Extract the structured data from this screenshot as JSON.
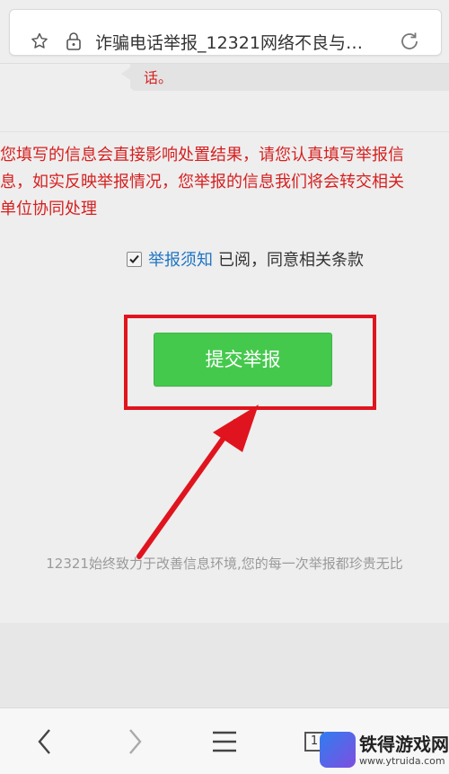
{
  "browser": {
    "url_title": "诈骗电话举报_12321网络不良与…",
    "icons": [
      "star-icon",
      "lock-icon",
      "reload-icon"
    ]
  },
  "page": {
    "bubble_text": "话。",
    "warning_lines": [
      "您填写的信息会直接影响处置结果，请您认真填写举报信",
      "息，如实反映举报情况，您举报的信息我们将会转交相关",
      "单位协同处理"
    ],
    "agree": {
      "checked": true,
      "link_text": "举报须知",
      "text": "已阅，同意相关条款"
    },
    "submit_label": "提交举报",
    "footer_text": "12321始终致力于改善信息环境,您的每一次举报都珍贵无比"
  },
  "nav": {
    "tab_count": "1",
    "icons": [
      "back-icon",
      "forward-icon",
      "menu-icon",
      "tabs-icon"
    ]
  },
  "watermark": {
    "title": "铁得游戏网",
    "url": "www.ytruida.com"
  },
  "colors": {
    "warning_red": "#d61f1f",
    "button_green": "#45c94d",
    "link_blue": "#1f74c4",
    "frame_red": "#e0141e"
  }
}
